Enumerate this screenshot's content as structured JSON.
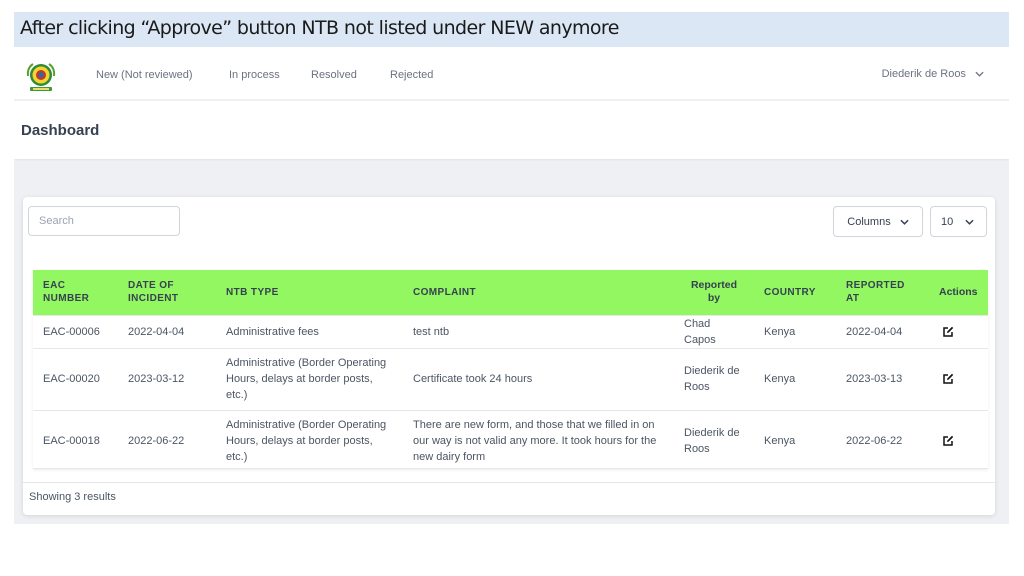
{
  "slide": {
    "title": "After clicking “Approve” button NTB not listed under NEW anymore"
  },
  "nav": {
    "logo_icon": "eac-emblem-icon",
    "links": [
      "New (Not reviewed)",
      "In process",
      "Resolved",
      "Rejected"
    ],
    "user": "Diederik de Roos",
    "user_icon": "chevron-down-icon"
  },
  "header": {
    "title": "Dashboard"
  },
  "toolbar": {
    "search_placeholder": "Search",
    "columns_label": "Columns",
    "page_size": "10"
  },
  "table": {
    "headers": {
      "eac_number": "EAC NUMBER",
      "date_of_incident": "DATE OF INCIDENT",
      "ntb_type": "NTB TYPE",
      "complaint": "COMPLAINT",
      "reported_by": "Reported by",
      "country": "COUNTRY",
      "reported_at": "REPORTED AT",
      "actions": "Actions"
    },
    "header_color": "#92f761",
    "rows": [
      {
        "eac_number": "EAC-00006",
        "date_of_incident": "2022-04-04",
        "ntb_type": "Administrative fees",
        "complaint": "test ntb",
        "reported_by": "Chad Capos",
        "country": "Kenya",
        "reported_at": "2022-04-04",
        "action_icon": "edit-icon"
      },
      {
        "eac_number": "EAC-00020",
        "date_of_incident": "2023-03-12",
        "ntb_type": "Administrative (Border Operating Hours, delays at border posts, etc.)",
        "complaint": "Certificate took 24 hours",
        "reported_by": "Diederik de Roos",
        "country": "Kenya",
        "reported_at": "2023-03-13",
        "action_icon": "edit-icon"
      },
      {
        "eac_number": "EAC-00018",
        "date_of_incident": "2022-06-22",
        "ntb_type": "Administrative (Border Operating Hours, delays at border posts, etc.)",
        "complaint": "There are new form, and those that we filled in on our way is not valid any more. It took hours for the new dairy form",
        "reported_by": "Diederik de Roos",
        "country": "Kenya",
        "reported_at": "2022-06-22",
        "action_icon": "edit-icon"
      }
    ]
  },
  "footer": {
    "results_text": "Showing 3 results"
  }
}
